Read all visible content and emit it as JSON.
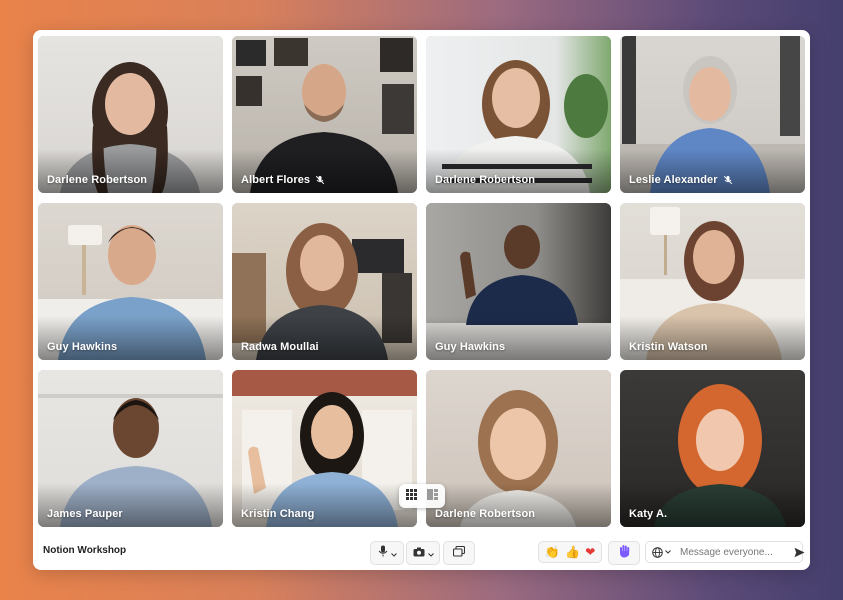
{
  "meeting": {
    "title": "Notion Workshop"
  },
  "participants": [
    {
      "name": "Darlene Robertson",
      "muted": false
    },
    {
      "name": "Albert Flores",
      "muted": true
    },
    {
      "name": "Darlene Robertson",
      "muted": false
    },
    {
      "name": "Leslie Alexander",
      "muted": true
    },
    {
      "name": "Guy Hawkins",
      "muted": false
    },
    {
      "name": "Radwa Moullai",
      "muted": false
    },
    {
      "name": "Guy Hawkins",
      "muted": false
    },
    {
      "name": "Kristin Watson",
      "muted": false
    },
    {
      "name": "James Pauper",
      "muted": false
    },
    {
      "name": "Kristin Chang",
      "muted": false
    },
    {
      "name": "Darlene Robertson",
      "muted": false
    },
    {
      "name": "Katy A.",
      "muted": false
    }
  ],
  "toolbar": {
    "mic_icon": "microphone-icon",
    "camera_icon": "camera-icon",
    "share_icon": "screen-share-icon",
    "reactions": [
      "👏",
      "👍",
      "❤"
    ],
    "raise_hand_icon": "raise-hand-icon",
    "language_icon": "globe-icon",
    "message_placeholder": "Message everyone...",
    "send_icon": "send-icon"
  },
  "layout_toggle": {
    "active": "grid",
    "options": [
      "grid-icon",
      "sidebar-layout-icon"
    ]
  },
  "colors": {
    "accent": "#7c5cff",
    "label_text": "#ffffff",
    "heart": "#e53935"
  }
}
